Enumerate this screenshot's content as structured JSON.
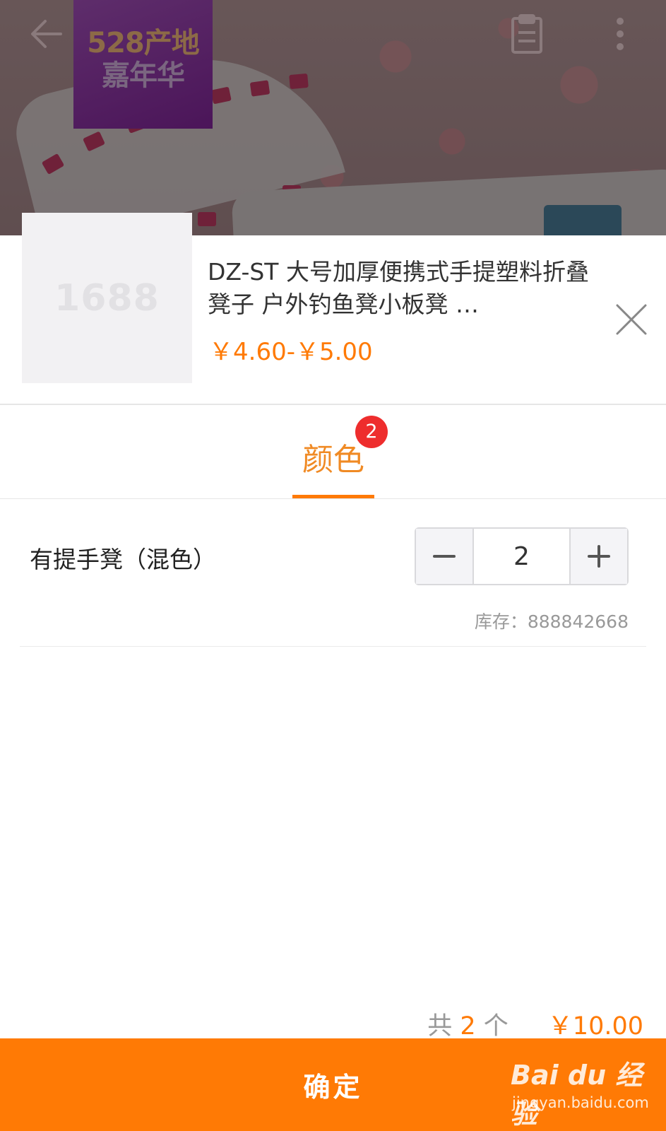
{
  "banner": {
    "badge_line1": "528产地",
    "badge_line2": "嘉年华"
  },
  "product": {
    "thumb_text": "1688",
    "title": "DZ-ST 大号加厚便携式手提塑料折叠凳子 户外钓鱼凳小板凳 …",
    "price_range": "￥4.60-￥5.00"
  },
  "tabs": [
    {
      "label": "颜色",
      "badge": "2",
      "active": true
    }
  ],
  "sku": {
    "name": "有提手凳（混色）",
    "quantity": "2",
    "stock": "库存：888842668"
  },
  "summary": {
    "prefix": "共 ",
    "count": "2",
    "suffix": " 个",
    "total": "￥10.00"
  },
  "confirm_label": "确定",
  "watermark": {
    "brand": "Bai du 经验",
    "url": "jingyan.baidu.com"
  },
  "colors": {
    "accent": "#ff7a05",
    "badge": "#ee2d2d"
  },
  "icons": [
    "back-arrow-icon",
    "clipboard-icon",
    "more-vertical-icon",
    "close-icon",
    "minus-icon",
    "plus-icon"
  ]
}
